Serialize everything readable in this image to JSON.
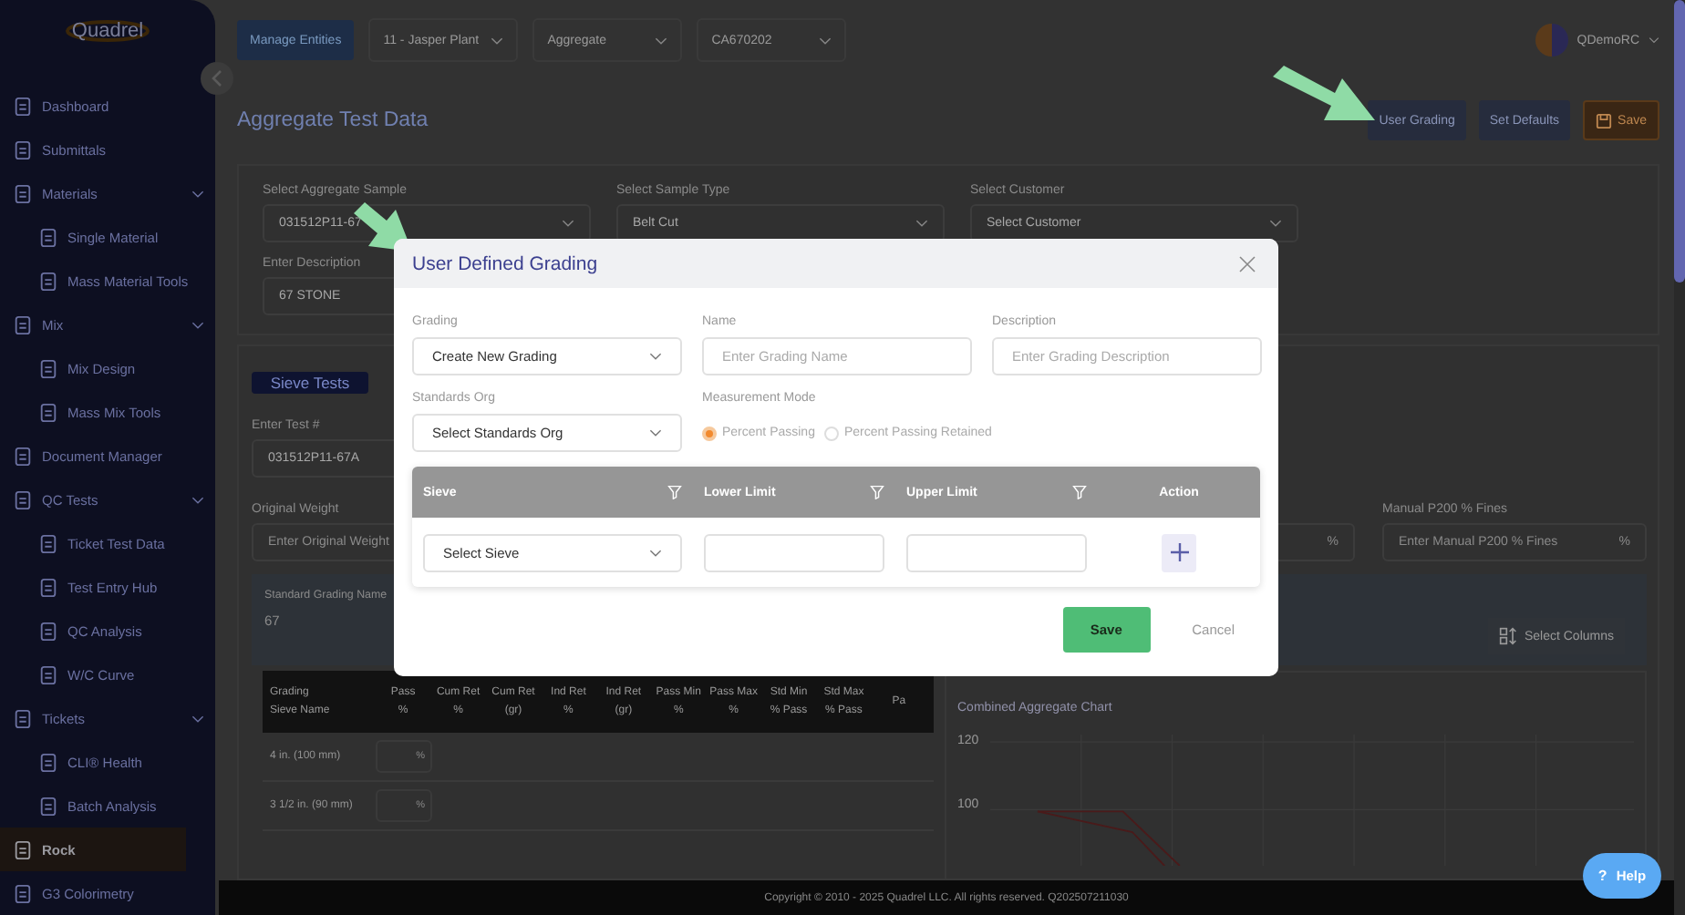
{
  "sidebar": {
    "logo": "Quadrel",
    "items": [
      {
        "label": "Dashboard",
        "selected": false
      },
      {
        "label": "Submittals",
        "selected": false
      },
      {
        "label": "Materials",
        "selected": false,
        "expanded": true,
        "children": [
          {
            "label": "Single Material",
            "selected": false
          },
          {
            "label": "Mass Material Tools",
            "selected": false
          }
        ]
      },
      {
        "label": "Mix",
        "selected": false,
        "expanded": true,
        "children": [
          {
            "label": "Mix Design",
            "selected": false
          },
          {
            "label": "Mass Mix Tools",
            "selected": false
          }
        ]
      },
      {
        "label": "Document Manager",
        "selected": false
      },
      {
        "label": "QC Tests",
        "selected": false,
        "expanded": true,
        "children": [
          {
            "label": "Ticket Test Data",
            "selected": false
          },
          {
            "label": "Test Entry Hub",
            "selected": false
          },
          {
            "label": "QC Analysis",
            "selected": false
          },
          {
            "label": "W/C Curve",
            "selected": false
          }
        ]
      },
      {
        "label": "Tickets",
        "selected": false,
        "expanded": true,
        "children": [
          {
            "label": "CLI® Health",
            "selected": false
          },
          {
            "label": "Batch Analysis",
            "selected": false
          }
        ]
      },
      {
        "label": "Rock",
        "selected": true
      },
      {
        "label": "G3 Colorimetry",
        "selected": false
      }
    ]
  },
  "top_bar": {
    "manage_button": "Manage Entities",
    "selects": [
      "11 - Jasper Plant",
      "Aggregate",
      "CA670202"
    ],
    "user": "QDemoRC"
  },
  "page": {
    "title": "Aggregate Test Data",
    "buttons": [
      {
        "label": "User Grading",
        "kind": "secondary"
      },
      {
        "label": "Set Defaults",
        "kind": "secondary"
      },
      {
        "label": "Save",
        "kind": "save"
      }
    ]
  },
  "sample_form": {
    "fields": [
      {
        "label": "Select Aggregate Sample",
        "value": "031512P11-67",
        "kind": "select"
      },
      {
        "label": "Select Sample Type",
        "value": "Belt Cut",
        "kind": "select"
      },
      {
        "label": "Select Customer",
        "value": "Select Customer",
        "kind": "select"
      },
      {
        "label": "Enter Description",
        "value": "67 STONE",
        "kind": "text"
      }
    ]
  },
  "test_form": {
    "tab": "Sieve Tests",
    "test_label": "Enter Test #",
    "test_value": "031512P11-67A",
    "weight_label": "Original Weight",
    "weight_placeholder": "Enter Original Weight",
    "partial_field_unit": "%",
    "fines_label": "Manual P200 % Fines",
    "fines_placeholder": "Enter Manual P200 % Fines",
    "fines_unit": "%"
  },
  "grading_panel": {
    "label": "Standard Grading Name",
    "value": "67",
    "columns_button": "Select Columns"
  },
  "table": {
    "columns": [
      [
        "Grading",
        "Sieve Name"
      ],
      [
        "Pass",
        "%"
      ],
      [
        "Cum Ret",
        "%"
      ],
      [
        "Cum Ret",
        "(gr)"
      ],
      [
        "Ind Ret",
        "%"
      ],
      [
        "Ind Ret",
        "(gr)"
      ],
      [
        "Pass Min",
        "%"
      ],
      [
        "Pass Max",
        "%"
      ],
      [
        "Std Min",
        "% Pass"
      ],
      [
        "Std Max",
        "% Pass"
      ],
      [
        "Pa"
      ]
    ],
    "rows": [
      {
        "sieve": "4 in. (100 mm)",
        "unit": "%"
      },
      {
        "sieve": "3 1/2 in. (90 mm)",
        "unit": "%"
      }
    ]
  },
  "chart": {
    "title": "Combined Aggregate Chart",
    "y_tick_labels": [
      "120",
      "100"
    ]
  },
  "footer": "Copyright © 2010 - 2025 Quadrel LLC. All rights reserved. Q202507211030",
  "help_button": {
    "icon": "?",
    "label": "Help"
  },
  "dialog": {
    "title": "User Defined Grading",
    "fields": [
      {
        "label": "Grading",
        "kind": "select",
        "value": "Create New Grading"
      },
      {
        "label": "Name",
        "kind": "text",
        "placeholder": "Enter Grading Name"
      },
      {
        "label": "Description",
        "kind": "text",
        "placeholder": "Enter Grading Description"
      },
      {
        "label": "Standards Org",
        "kind": "select",
        "value": "Select Standards Org"
      },
      {
        "label": "Measurement Mode",
        "kind": "radio",
        "options": [
          {
            "label": "Percent Passing",
            "selected": true
          },
          {
            "label": "Percent Passing Retained",
            "selected": false
          }
        ]
      }
    ],
    "grid": {
      "columns": [
        {
          "label": "Sieve",
          "filter": true
        },
        {
          "label": "Lower Limit",
          "filter": true
        },
        {
          "label": "Upper Limit",
          "filter": true
        },
        {
          "label": "Action",
          "filter": false
        }
      ],
      "sieve_select": "Select Sieve"
    },
    "save": "Save",
    "cancel": "Cancel"
  }
}
